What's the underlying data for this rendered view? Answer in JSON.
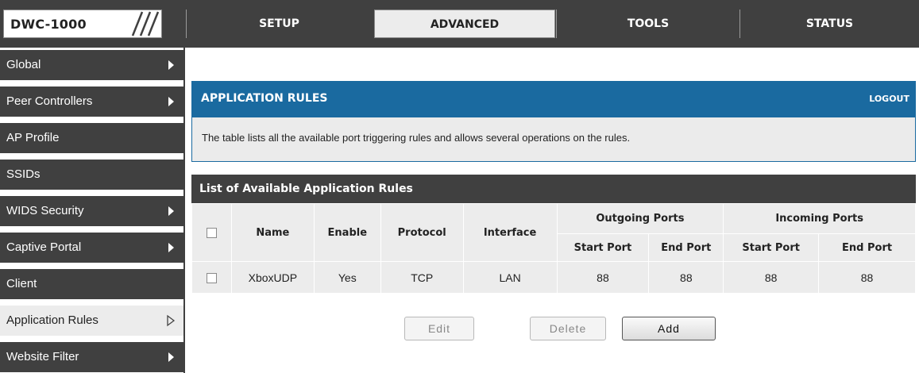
{
  "brand": {
    "name": "DWC-1000"
  },
  "nav": {
    "tabs": [
      {
        "label": "SETUP",
        "active": false
      },
      {
        "label": "ADVANCED",
        "active": true
      },
      {
        "label": "TOOLS",
        "active": false
      },
      {
        "label": "STATUS",
        "active": false
      }
    ]
  },
  "sidebar": {
    "items": [
      {
        "label": "Global",
        "icon": "arrow-right-icon"
      },
      {
        "label": "Peer Controllers",
        "icon": "arrow-right-icon"
      },
      {
        "label": "AP Profile",
        "icon": ""
      },
      {
        "label": "SSIDs",
        "icon": ""
      },
      {
        "label": "WIDS Security",
        "icon": "arrow-right-icon"
      },
      {
        "label": "Captive Portal",
        "icon": "arrow-right-icon"
      },
      {
        "label": "Client",
        "icon": ""
      },
      {
        "label": "Application Rules",
        "icon": "hollow-arrow-right-icon",
        "active": true
      },
      {
        "label": "Website Filter",
        "icon": "arrow-right-icon"
      }
    ]
  },
  "header": {
    "title": "APPLICATION RULES",
    "logout": "LOGOUT"
  },
  "description": "The table lists all the available port triggering rules and allows several operations on the rules.",
  "list": {
    "title": "List of Available Application Rules",
    "columns": {
      "name": "Name",
      "enable": "Enable",
      "protocol": "Protocol",
      "interface": "Interface",
      "outgoing": "Outgoing Ports",
      "incoming": "Incoming Ports",
      "start_port": "Start Port",
      "end_port": "End Port"
    },
    "rows": [
      {
        "name": "XboxUDP",
        "enable": "Yes",
        "protocol": "TCP",
        "interface": "LAN",
        "out_start": "88",
        "out_end": "88",
        "in_start": "88",
        "in_end": "88"
      }
    ]
  },
  "buttons": {
    "edit": "Edit",
    "delete": "Delete",
    "add": "Add"
  },
  "colors": {
    "nav_dark": "#404040",
    "header_blue": "#1a6aa0",
    "panel_grey": "#ececec"
  }
}
